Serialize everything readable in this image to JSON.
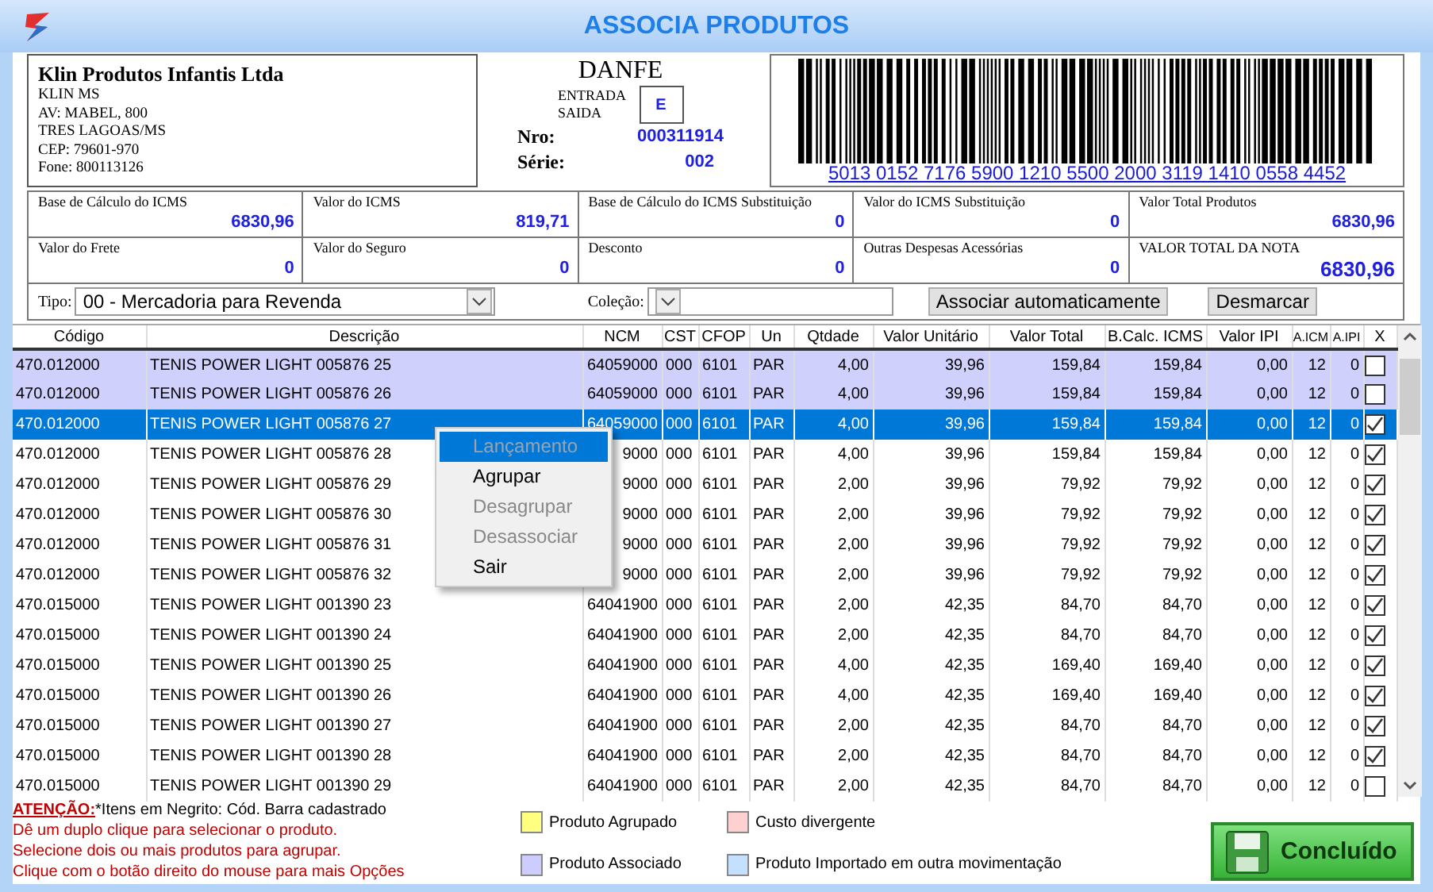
{
  "window": {
    "title": "ASSOCIA PRODUTOS"
  },
  "company": {
    "name": "Klin Produtos Infantis Ltda",
    "lines": [
      "KLIN MS",
      "AV: MABEL, 800",
      "TRES LAGOAS/MS",
      "CEP: 79601-970",
      "Fone: 800113126"
    ]
  },
  "danfe": {
    "title": "DANFE",
    "entry_label": "ENTRADA",
    "exit_label": "SAIDA",
    "type": "E",
    "number_label": "Nro:",
    "number": "000311914",
    "series_label": "Série:",
    "series": "002"
  },
  "barcode": {
    "digits": "5013 0152 7176 5900 1210 5500 2000 3119 1410 0558 4452"
  },
  "totals": [
    {
      "label": "Base de  Cálculo do ICMS",
      "value": "6830,96",
      "large": false
    },
    {
      "label": "Valor do ICMS",
      "value": "819,71",
      "large": false
    },
    {
      "label": "Base de  Cálculo do ICMS Substituição",
      "value": "0",
      "large": false
    },
    {
      "label": "Valor do ICMS Substituição",
      "value": "0",
      "large": false
    },
    {
      "label": "Valor Total Produtos",
      "value": "6830,96",
      "large": false
    },
    {
      "label": "Valor do Frete",
      "value": "0",
      "large": false
    },
    {
      "label": "Valor do Seguro",
      "value": "0",
      "large": false
    },
    {
      "label": "Desconto",
      "value": "0",
      "large": false
    },
    {
      "label": "Outras Despesas Acessórias",
      "value": "0",
      "large": false
    },
    {
      "label": "VALOR TOTAL DA NOTA",
      "value": "6830,96",
      "large": true
    }
  ],
  "filters": {
    "type_label": "Tipo:",
    "type_value": "00 - Mercadoria para Revenda",
    "collection_label": "Coleção:",
    "auto_button": "Associar automaticamente",
    "clear_button": "Desmarcar"
  },
  "table": {
    "columns": [
      "Código",
      "Descrição",
      "NCM",
      "CST",
      "CFOP",
      "Un",
      "Qtdade",
      "Valor Unitário",
      "Valor Total",
      "B.Calc. ICMS",
      "Valor IPI",
      "A.ICM",
      "A.IPI",
      "X"
    ],
    "rows": [
      {
        "cells": [
          "470.012000",
          "TENIS POWER LIGHT 005876 25",
          "64059000",
          "000",
          "6101",
          "PAR",
          "4,00",
          "39,96",
          "159,84",
          "159,84",
          "0,00",
          "12",
          "0"
        ],
        "associated": true,
        "selected": false,
        "checked": false
      },
      {
        "cells": [
          "470.012000",
          "TENIS POWER LIGHT 005876 26",
          "64059000",
          "000",
          "6101",
          "PAR",
          "4,00",
          "39,96",
          "159,84",
          "159,84",
          "0,00",
          "12",
          "0"
        ],
        "associated": true,
        "selected": false,
        "checked": false
      },
      {
        "cells": [
          "470.012000",
          "TENIS POWER LIGHT 005876 27",
          "64059000",
          "000",
          "6101",
          "PAR",
          "4,00",
          "39,96",
          "159,84",
          "159,84",
          "0,00",
          "12",
          "0"
        ],
        "associated": false,
        "selected": true,
        "checked": true
      },
      {
        "cells": [
          "470.012000",
          "TENIS POWER LIGHT 005876 28",
          "9000",
          "000",
          "6101",
          "PAR",
          "4,00",
          "39,96",
          "159,84",
          "159,84",
          "0,00",
          "12",
          "0"
        ],
        "associated": false,
        "selected": false,
        "checked": true
      },
      {
        "cells": [
          "470.012000",
          "TENIS POWER LIGHT 005876 29",
          "9000",
          "000",
          "6101",
          "PAR",
          "2,00",
          "39,96",
          "79,92",
          "79,92",
          "0,00",
          "12",
          "0"
        ],
        "associated": false,
        "selected": false,
        "checked": true
      },
      {
        "cells": [
          "470.012000",
          "TENIS POWER LIGHT 005876 30",
          "9000",
          "000",
          "6101",
          "PAR",
          "2,00",
          "39,96",
          "79,92",
          "79,92",
          "0,00",
          "12",
          "0"
        ],
        "associated": false,
        "selected": false,
        "checked": true
      },
      {
        "cells": [
          "470.012000",
          "TENIS POWER LIGHT 005876 31",
          "9000",
          "000",
          "6101",
          "PAR",
          "2,00",
          "39,96",
          "79,92",
          "79,92",
          "0,00",
          "12",
          "0"
        ],
        "associated": false,
        "selected": false,
        "checked": true
      },
      {
        "cells": [
          "470.012000",
          "TENIS POWER LIGHT 005876 32",
          "9000",
          "000",
          "6101",
          "PAR",
          "2,00",
          "39,96",
          "79,92",
          "79,92",
          "0,00",
          "12",
          "0"
        ],
        "associated": false,
        "selected": false,
        "checked": true
      },
      {
        "cells": [
          "470.015000",
          "TENIS POWER LIGHT 001390 23",
          "64041900",
          "000",
          "6101",
          "PAR",
          "2,00",
          "42,35",
          "84,70",
          "84,70",
          "0,00",
          "12",
          "0"
        ],
        "associated": false,
        "selected": false,
        "checked": true
      },
      {
        "cells": [
          "470.015000",
          "TENIS POWER LIGHT 001390 24",
          "64041900",
          "000",
          "6101",
          "PAR",
          "2,00",
          "42,35",
          "84,70",
          "84,70",
          "0,00",
          "12",
          "0"
        ],
        "associated": false,
        "selected": false,
        "checked": true
      },
      {
        "cells": [
          "470.015000",
          "TENIS POWER LIGHT 001390 25",
          "64041900",
          "000",
          "6101",
          "PAR",
          "4,00",
          "42,35",
          "169,40",
          "169,40",
          "0,00",
          "12",
          "0"
        ],
        "associated": false,
        "selected": false,
        "checked": true
      },
      {
        "cells": [
          "470.015000",
          "TENIS POWER LIGHT 001390 26",
          "64041900",
          "000",
          "6101",
          "PAR",
          "4,00",
          "42,35",
          "169,40",
          "169,40",
          "0,00",
          "12",
          "0"
        ],
        "associated": false,
        "selected": false,
        "checked": true
      },
      {
        "cells": [
          "470.015000",
          "TENIS POWER LIGHT 001390 27",
          "64041900",
          "000",
          "6101",
          "PAR",
          "2,00",
          "42,35",
          "84,70",
          "84,70",
          "0,00",
          "12",
          "0"
        ],
        "associated": false,
        "selected": false,
        "checked": true
      },
      {
        "cells": [
          "470.015000",
          "TENIS POWER LIGHT 001390 28",
          "64041900",
          "000",
          "6101",
          "PAR",
          "2,00",
          "42,35",
          "84,70",
          "84,70",
          "0,00",
          "12",
          "0"
        ],
        "associated": false,
        "selected": false,
        "checked": true
      },
      {
        "cells": [
          "470.015000",
          "TENIS POWER LIGHT 001390 29",
          "64041900",
          "000",
          "6101",
          "PAR",
          "2,00",
          "42,35",
          "84,70",
          "84,70",
          "0,00",
          "12",
          "0"
        ],
        "associated": false,
        "selected": false,
        "checked": false
      }
    ]
  },
  "context_menu": {
    "items": [
      {
        "label": "Lançamento",
        "disabled": true,
        "highlighted": true
      },
      {
        "label": "Agrupar",
        "disabled": false,
        "highlighted": false
      },
      {
        "label": "Desagrupar",
        "disabled": true,
        "highlighted": false
      },
      {
        "label": "Desassociar",
        "disabled": true,
        "highlighted": false
      },
      {
        "label": "Sair",
        "disabled": false,
        "highlighted": false
      }
    ]
  },
  "notes": {
    "attention_label": "ATENÇÃO:",
    "attention_text": "*Itens em Negrito: Cód. Barra cadastrado",
    "lines": [
      "Dê um duplo clique para selecionar o produto.",
      "Selecione dois ou mais produtos para agrupar.",
      "Clique com o botão direito do mouse para mais Opções"
    ]
  },
  "legend": [
    {
      "label": "Produto Agrupado",
      "color": "#ffff80"
    },
    {
      "label": "Custo divergente",
      "color": "#ffd0d0"
    },
    {
      "label": "Produto Associado",
      "color": "#ccccff"
    },
    {
      "label": "Produto Importado em outra movimentação",
      "color": "#c4e0ff"
    }
  ],
  "done_button": {
    "label": "Concluído"
  }
}
